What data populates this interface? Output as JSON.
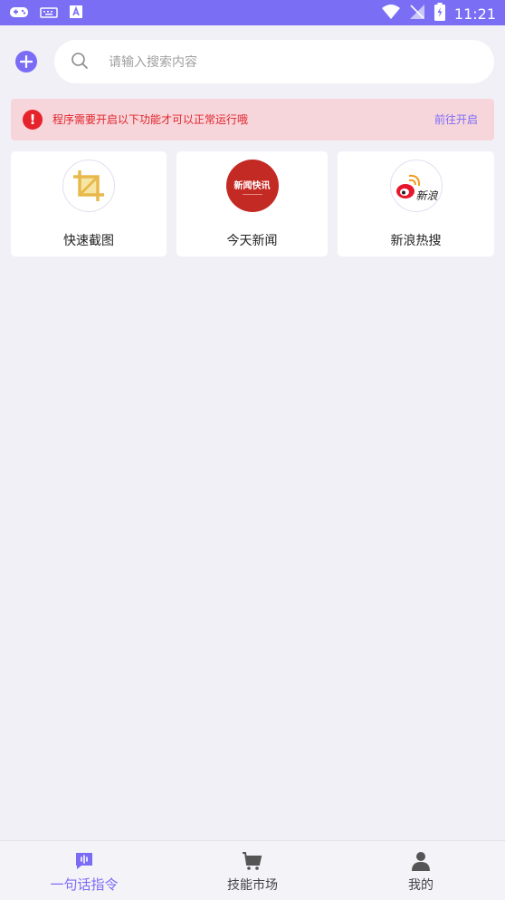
{
  "status_bar": {
    "time": "11:21",
    "color": "#7a6ef5"
  },
  "search": {
    "placeholder": "请输入搜索内容"
  },
  "alert": {
    "message": "程序需要开启以下功能才可以正常运行哦",
    "action": "前往开启"
  },
  "tiles": [
    {
      "label": "快速截图",
      "icon": "crop-icon"
    },
    {
      "label": "今天新闻",
      "icon": "news-logo-icon",
      "logo_text": "新闻快讯"
    },
    {
      "label": "新浪热搜",
      "icon": "weibo-icon",
      "logo_text": "新浪"
    }
  ],
  "bottom_nav": [
    {
      "label": "一句话指令",
      "icon": "voice-command-icon",
      "active": true
    },
    {
      "label": "技能市场",
      "icon": "cart-icon",
      "active": false
    },
    {
      "label": "我的",
      "icon": "user-icon",
      "active": false
    }
  ],
  "colors": {
    "accent": "#7b6cf6",
    "alert_bg": "#f7d6db",
    "alert_text": "#e0242c"
  }
}
